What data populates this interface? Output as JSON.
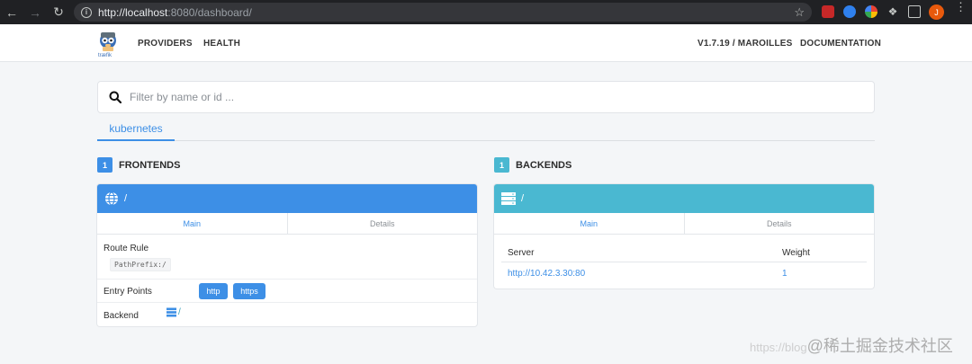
{
  "browser": {
    "url_host": "http://localhost",
    "url_rest": ":8080/dashboard/",
    "profile_initial": "J"
  },
  "appnav": {
    "logo_text": "træfik",
    "links": [
      "PROVIDERS",
      "HEALTH"
    ],
    "version": "V1.7.19 / MAROILLES",
    "documentation": "DOCUMENTATION"
  },
  "search": {
    "placeholder": "Filter by name or id ..."
  },
  "provider_tab": "kubernetes",
  "frontends": {
    "count": "1",
    "title": "FRONTENDS",
    "card_title": "/",
    "tabs": [
      "Main",
      "Details"
    ],
    "route_rule_label": "Route Rule",
    "route_rule_value": "PathPrefix:/",
    "entry_points_label": "Entry Points",
    "entry_points": [
      "http",
      "https"
    ],
    "backend_label": "Backend",
    "backend_value": "/"
  },
  "backends": {
    "count": "1",
    "title": "BACKENDS",
    "card_title": "/",
    "tabs": [
      "Main",
      "Details"
    ],
    "columns": [
      "Server",
      "Weight"
    ],
    "rows": [
      {
        "server": "http://10.42.3.30:80",
        "weight": "1"
      }
    ]
  },
  "watermark": {
    "faint": "https://blog",
    "main": "@稀土掘金技术社区"
  },
  "colors": {
    "frontend_accent": "#3d8fe6",
    "backend_accent": "#4ab8d1",
    "chrome_bg": "#202124"
  },
  "icons": [
    "back-arrow-icon",
    "forward-arrow-icon",
    "reload-icon",
    "info-icon",
    "star-icon",
    "search-icon",
    "globe-icon",
    "server-icon"
  ]
}
